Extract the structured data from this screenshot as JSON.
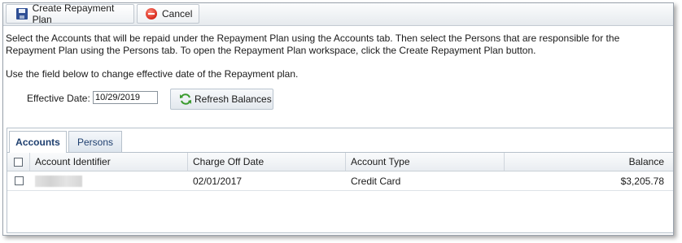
{
  "toolbar": {
    "create_label": "Create Repayment Plan",
    "cancel_label": "Cancel",
    "icons": [
      "save-icon",
      "cancel-icon"
    ]
  },
  "instructions": {
    "paragraph1": "Select the Accounts that will be repaid under the Repayment Plan using the Accounts tab. Then select the Persons that are responsible for the Repayment Plan using the Persons tab. To open the Repayment Plan workspace, click the Create Repayment Plan button.",
    "paragraph2": "Use the field below to change effective date of the Repayment plan."
  },
  "effective_date": {
    "label": "Effective Date:",
    "value": "10/29/2019"
  },
  "refresh": {
    "label": "Refresh Balances",
    "icon": "refresh-icon"
  },
  "tabs": [
    {
      "label": "Accounts",
      "active": true
    },
    {
      "label": "Persons",
      "active": false
    }
  ],
  "grid": {
    "columns": [
      "Account Identifier",
      "Charge Off Date",
      "Account Type",
      "Balance"
    ],
    "rows": [
      {
        "account_identifier": "",
        "charge_off_date": "02/01/2017",
        "account_type": "Credit Card",
        "balance": "$3,205.78",
        "checked": false
      }
    ]
  },
  "colors": {
    "tab_text": "#1e3f6f",
    "border": "#b7c1cb",
    "cancel_icon": "#d6281b",
    "save_icon": "#2f4f95"
  }
}
